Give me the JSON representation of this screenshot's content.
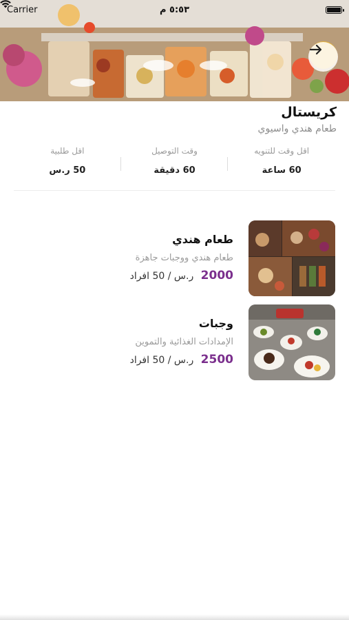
{
  "status_bar": {
    "carrier": "Carrier",
    "time": "٥:٥٣ م"
  },
  "restaurant": {
    "name": "كريستال",
    "cuisine": "طعام هندي واسيوي"
  },
  "stats": [
    {
      "label": "اقل وقت للتنويه",
      "value": "60 ساعة"
    },
    {
      "label": "وقت التوصيل",
      "value": "60 دقيقة"
    },
    {
      "label": "اقل طلبية",
      "value": "50 ر.س"
    }
  ],
  "menu": [
    {
      "name": "طعام هندي",
      "description": "طعام هندي ووجبات جاهزة",
      "price": "2000",
      "unit": "ر.س / 50 افراد"
    },
    {
      "name": "وجبات",
      "description": "الإمدادات الغذائية والتموين",
      "price": "2500",
      "unit": "ر.س / 50 افراد"
    }
  ],
  "colors": {
    "accent": "#7b2f8d"
  },
  "icons": {
    "back": "arrow-right-icon",
    "wifi": "wifi-icon",
    "battery": "battery-icon"
  }
}
